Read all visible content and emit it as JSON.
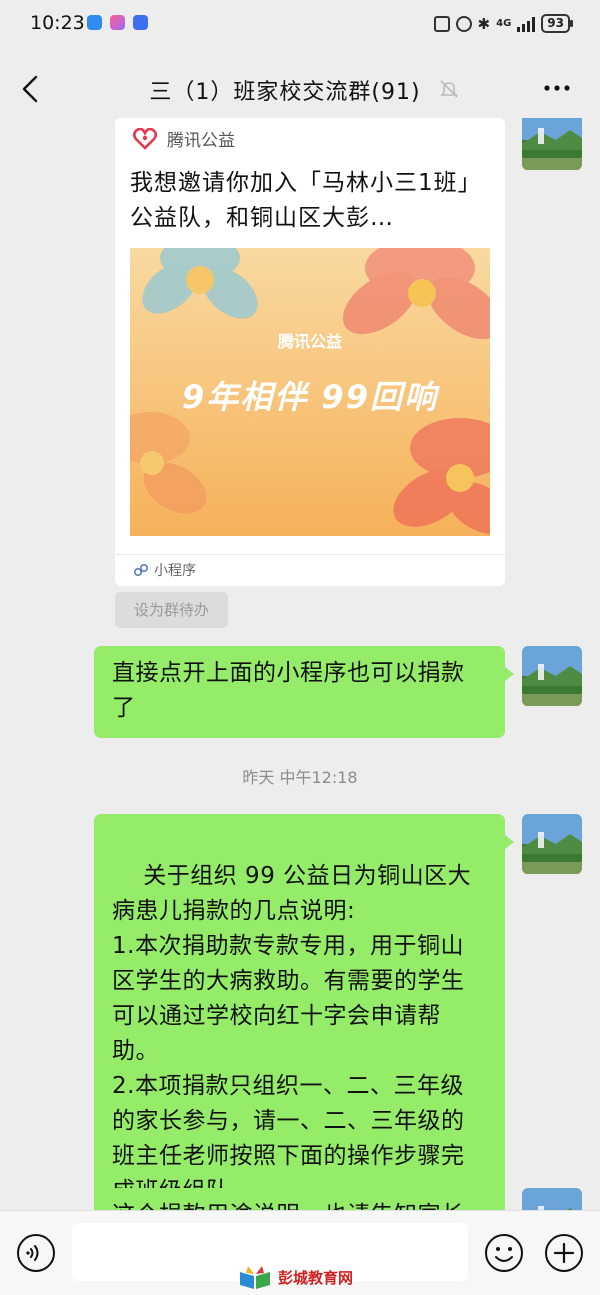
{
  "status_bar": {
    "time": "10:23",
    "network": "4G",
    "battery": "93"
  },
  "header": {
    "back_icon": "chevron-left-icon",
    "title": "三（1）班家校交流群(91)",
    "mute_icon": "bell-off-icon",
    "more_icon": "more-dots-icon"
  },
  "messages": {
    "share_card": {
      "brand": "腾讯公益",
      "title": "我想邀请你加入「马林小三1班」公益队，和铜山区大彭…",
      "banner_brand": "腾讯公益",
      "banner_slogan": "9年相伴 99回响",
      "footer": "小程序"
    },
    "set_todo": "设为群待办",
    "msg1": "直接点开上面的小程序也可以捐款了",
    "timestamp": "昨天 中午12:18",
    "msg2": "关于组织 99 公益日为铜山区大病患儿捐款的几点说明:\n1.本次捐助款专款专用，用于铜山区学生的大病救助。有需要的学生可以通过学校向红十字会申请帮助。\n2.本项捐款只组织一、二、三年级的家长参与，请一、二、三年级的班主任老师按照下面的操作步骤完成班级组队。",
    "msg3_partial": "这个捐款用途说明，也请告知家长"
  },
  "input_bar": {
    "voice_icon": "voice-icon",
    "emoji_icon": "emoji-icon",
    "plus_icon": "plus-icon"
  },
  "watermark": {
    "text": "彭城教育网"
  },
  "colors": {
    "background": "#ededed",
    "bubble_green": "#95ec69",
    "card_white": "#ffffff",
    "brand_red": "#e8364a"
  }
}
